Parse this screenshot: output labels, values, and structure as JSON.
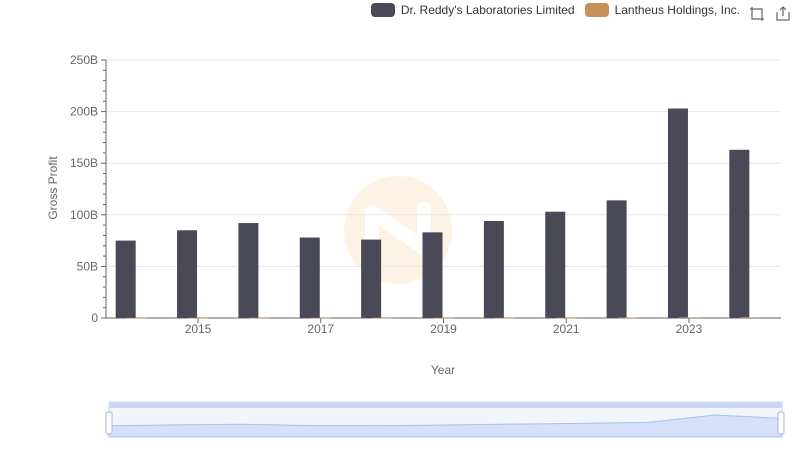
{
  "legend": {
    "items": [
      {
        "label": "Dr. Reddy's Laboratories Limited",
        "color": "#4a4958"
      },
      {
        "label": "Lantheus Holdings, Inc.",
        "color": "#c8915c"
      }
    ]
  },
  "toolbox": {
    "icons": [
      "restore-icon",
      "save-as-image-icon"
    ]
  },
  "chart_data": {
    "type": "bar",
    "categories": [
      2014,
      2015,
      2016,
      2017,
      2018,
      2019,
      2020,
      2021,
      2022,
      2023,
      2024
    ],
    "x_tick_labels": [
      "2015",
      "2017",
      "2019",
      "2021",
      "2023"
    ],
    "series": [
      {
        "name": "Dr. Reddy's Laboratories Limited",
        "color": "#4a4958",
        "values": [
          75,
          85,
          92,
          78,
          76,
          83,
          94,
          103,
          114,
          203,
          163
        ]
      },
      {
        "name": "Lantheus Holdings, Inc.",
        "color": "#c8915c",
        "values": [
          0.2,
          0.2,
          0.2,
          0.2,
          0.2,
          0.2,
          0.2,
          0.2,
          0.5,
          0.6,
          0.7
        ]
      }
    ],
    "xlabel": "Year",
    "ylabel": "Gross Profit",
    "ylim": [
      0,
      250
    ],
    "y_ticks": [
      "0",
      "50B",
      "100B",
      "150B",
      "200B",
      "250B"
    ],
    "grid": true,
    "legend_position": "top-right"
  }
}
